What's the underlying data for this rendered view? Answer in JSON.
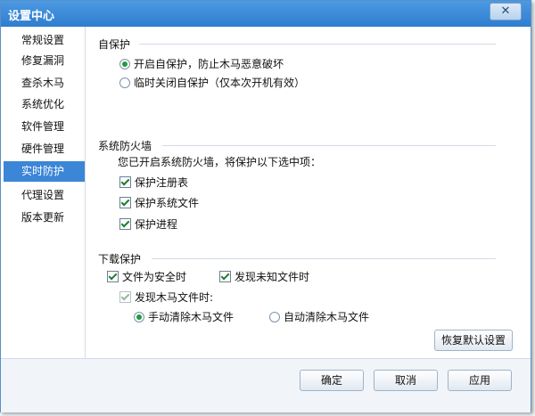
{
  "window": {
    "title": "设置中心",
    "close_label": "✕"
  },
  "sidebar": {
    "items": [
      {
        "label": "常规设置"
      },
      {
        "label": "修复漏洞"
      },
      {
        "label": "查杀木马"
      },
      {
        "label": "系统优化"
      },
      {
        "label": "软件管理"
      },
      {
        "label": "硬件管理"
      },
      {
        "label": "实时防护",
        "active": true
      },
      {
        "label": "代理设置"
      },
      {
        "label": "版本更新"
      }
    ]
  },
  "self_protect": {
    "title": "自保护",
    "options": [
      {
        "label": "开启自保护，防止木马恶意破坏",
        "selected": true
      },
      {
        "label": "临时关闭自保护（仅本次开机有效）",
        "selected": false
      }
    ]
  },
  "firewall": {
    "title": "系统防火墙",
    "desc": "您已开启系统防火墙，将保护以下选中项：",
    "items": [
      {
        "label": "保护注册表",
        "checked": true
      },
      {
        "label": "保护系统文件",
        "checked": true
      },
      {
        "label": "保护进程",
        "checked": true
      }
    ]
  },
  "download": {
    "title": "下载保护",
    "safe_file": {
      "label": "文件为安全时",
      "checked": true
    },
    "unknown_file": {
      "label": "发现未知文件时",
      "checked": true
    },
    "trojan_file": {
      "label": "发现木马文件时:",
      "checked": true,
      "disabled": true
    },
    "options": [
      {
        "label": "手动清除木马文件",
        "selected": true
      },
      {
        "label": "自动清除木马文件",
        "selected": false
      }
    ]
  },
  "buttons": {
    "restore_default": "恢复默认设置",
    "ok": "确定",
    "cancel": "取消",
    "apply": "应用"
  }
}
